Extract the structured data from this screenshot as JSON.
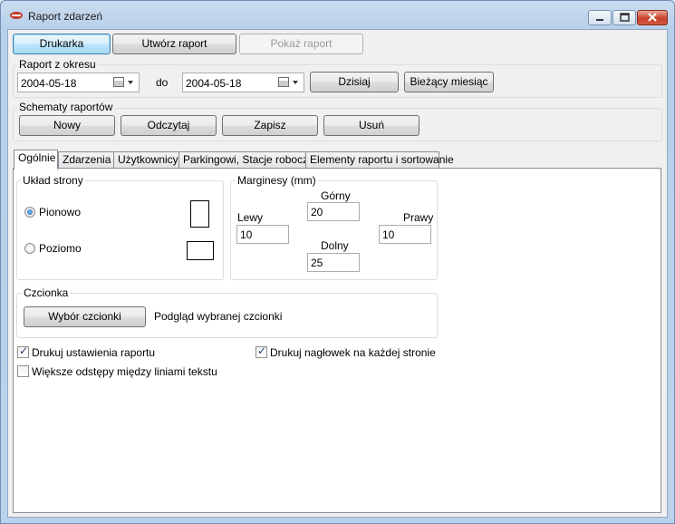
{
  "window": {
    "title": "Raport zdarzeń"
  },
  "toolbar": {
    "printer": "Drukarka",
    "create": "Utwórz raport",
    "show": "Pokaż raport"
  },
  "period": {
    "label": "Raport z okresu",
    "from": "2004-05-18",
    "to_label": "do",
    "to": "2004-05-18",
    "today": "Dzisiaj",
    "current_month": "Bieżący miesiąc"
  },
  "schemes": {
    "label": "Schematy raportów",
    "new": "Nowy",
    "read": "Odczytaj",
    "save": "Zapisz",
    "delete": "Usuń"
  },
  "tabs": [
    "Ogólnie",
    "Zdarzenia",
    "Użytkownicy",
    "Parkingowi, Stacje robocze",
    "Elementy raportu i sortowanie"
  ],
  "layout": {
    "label": "Układ strony",
    "portrait": "Pionowo",
    "landscape": "Poziomo",
    "selected": "Pionowo"
  },
  "margins": {
    "label": "Marginesy (mm)",
    "top_label": "Górny",
    "top": "20",
    "left_label": "Lewy",
    "left": "10",
    "right_label": "Prawy",
    "right": "10",
    "bottom_label": "Dolny",
    "bottom": "25"
  },
  "font": {
    "label": "Czcionka",
    "choose": "Wybór czcionki",
    "preview": "Podgląd wybranej czcionki"
  },
  "options": {
    "print_settings": {
      "label": "Drukuj ustawienia raportu",
      "checked": true
    },
    "header_each_page": {
      "label": "Drukuj nagłowek na każdej stronie",
      "checked": true
    },
    "wider_spacing": {
      "label": "Większe odstępy między liniami tekstu",
      "checked": false
    }
  }
}
